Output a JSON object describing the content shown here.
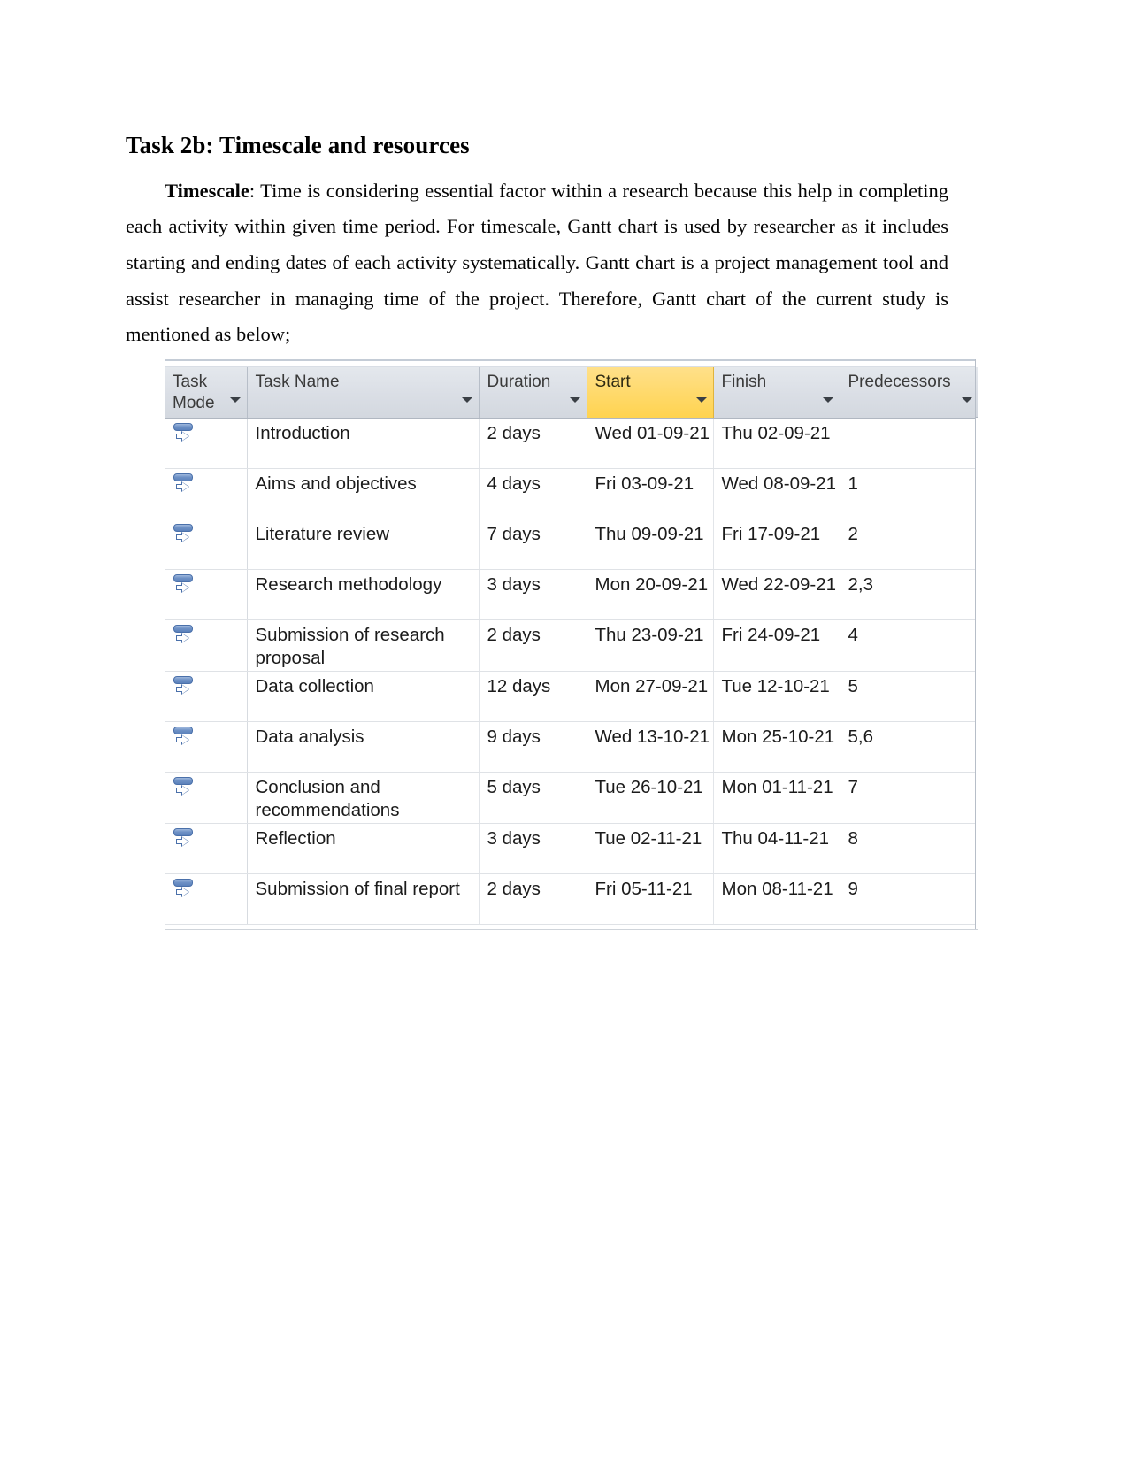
{
  "document": {
    "heading": "Task 2b: Timescale and resources",
    "paragraph_lead": "Timescale",
    "paragraph_rest": ": Time is considering essential factor within a research because this help in completing each activity within given time period. For timescale, Gantt chart is used by researcher as it includes starting and ending dates of each activity systematically. Gantt chart is a project management tool and assist researcher in managing time of the project. Therefore, Gantt chart of the current study is mentioned as below;"
  },
  "colors": {
    "header_background": "#dde1e7",
    "header_highlight": "#ffd966",
    "grid_line": "#dfe2e6",
    "icon_blue": "#5b81bb"
  },
  "gantt_table": {
    "columns": [
      {
        "key": "task_mode",
        "label": "Task Mode",
        "has_filter": true,
        "highlighted": false
      },
      {
        "key": "task_name",
        "label": "Task Name",
        "has_filter": true,
        "highlighted": false
      },
      {
        "key": "duration",
        "label": "Duration",
        "has_filter": true,
        "highlighted": false
      },
      {
        "key": "start",
        "label": "Start",
        "has_filter": true,
        "highlighted": true
      },
      {
        "key": "finish",
        "label": "Finish",
        "has_filter": true,
        "highlighted": false
      },
      {
        "key": "predecessors",
        "label": "Predecessors",
        "has_filter": true,
        "highlighted": false
      }
    ],
    "task_mode_icon": "manually-scheduled-icon",
    "rows": [
      {
        "task_name": "Introduction",
        "duration": "2 days",
        "start": "Wed 01-09-21",
        "finish": "Thu 02-09-21",
        "predecessors": ""
      },
      {
        "task_name": "Aims and objectives",
        "duration": "4 days",
        "start": "Fri 03-09-21",
        "finish": "Wed 08-09-21",
        "predecessors": "1"
      },
      {
        "task_name": "Literature review",
        "duration": "7 days",
        "start": "Thu 09-09-21",
        "finish": "Fri 17-09-21",
        "predecessors": "2"
      },
      {
        "task_name": "Research methodology",
        "duration": "3 days",
        "start": "Mon 20-09-21",
        "finish": "Wed 22-09-21",
        "predecessors": "2,3"
      },
      {
        "task_name": "Submission of research proposal",
        "duration": "2 days",
        "start": "Thu 23-09-21",
        "finish": "Fri 24-09-21",
        "predecessors": "4"
      },
      {
        "task_name": "Data collection",
        "duration": "12 days",
        "start": "Mon 27-09-21",
        "finish": "Tue 12-10-21",
        "predecessors": "5"
      },
      {
        "task_name": "Data analysis",
        "duration": "9 days",
        "start": "Wed 13-10-21",
        "finish": "Mon 25-10-21",
        "predecessors": "5,6"
      },
      {
        "task_name": "Conclusion and recommendations",
        "duration": "5 days",
        "start": "Tue 26-10-21",
        "finish": "Mon 01-11-21",
        "predecessors": "7"
      },
      {
        "task_name": "Reflection",
        "duration": "3 days",
        "start": "Tue 02-11-21",
        "finish": "Thu 04-11-21",
        "predecessors": "8"
      },
      {
        "task_name": "Submission of final report",
        "duration": "2 days",
        "start": "Fri 05-11-21",
        "finish": "Mon 08-11-21",
        "predecessors": "9"
      }
    ]
  }
}
